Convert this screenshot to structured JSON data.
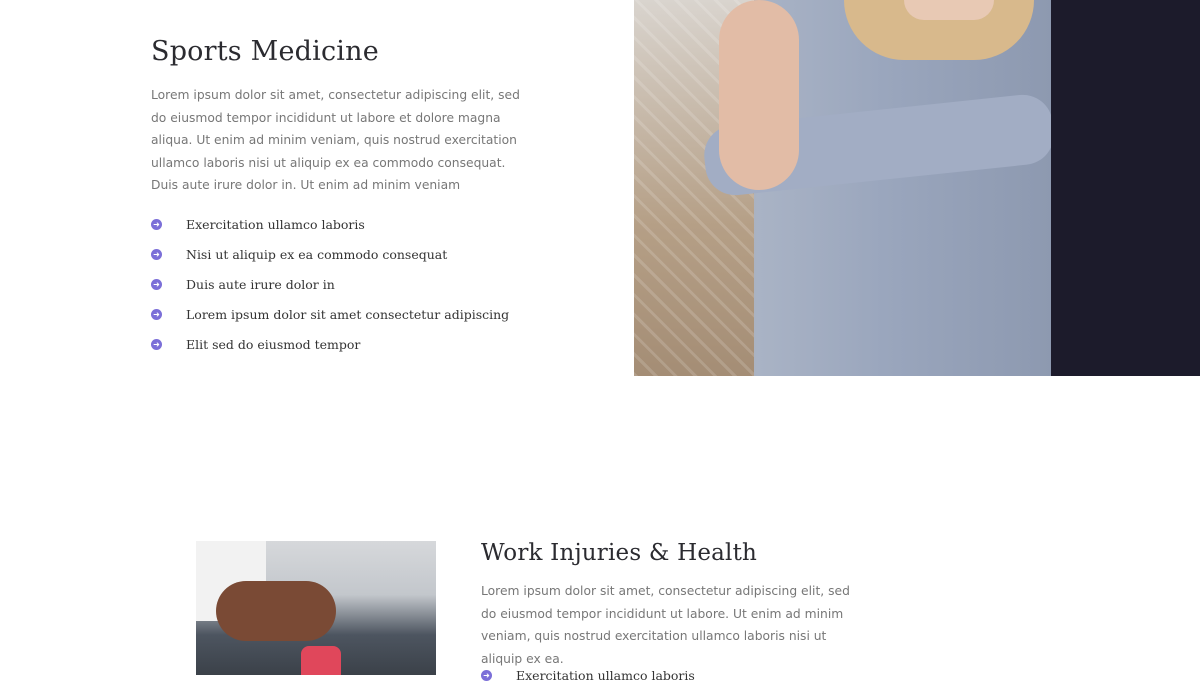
{
  "section1": {
    "title": "Sports Medicine",
    "body": "Lorem ipsum dolor sit amet, consectetur adipiscing elit, sed do eiusmod tempor incididunt ut labore et dolore magna aliqua. Ut enim ad minim veniam, quis nostrud exercitation ullamco laboris nisi ut aliquip ex ea commodo consequat. Duis aute irure dolor in. Ut enim ad minim veniam",
    "items": [
      "Exercitation ullamco laboris",
      "Nisi ut aliquip ex ea commodo consequat",
      "Duis aute irure dolor in",
      "Lorem ipsum dolor sit amet consectetur adipiscing",
      "Elit sed do eiusmod tempor"
    ]
  },
  "section2": {
    "title": "Work Injuries & Health",
    "body": "Lorem ipsum dolor sit amet, consectetur adipiscing elit, sed do eiusmod tempor incididunt ut labore. Ut enim ad minim veniam, quis nostrud exercitation ullamco laboris nisi ut aliquip ex ea.",
    "items": [
      "Exercitation ullamco laboris"
    ]
  },
  "colors": {
    "accent": "#7b6fd8",
    "dark_panel": "#1c1b2b"
  },
  "icons": {
    "bullet": "arrow-circle-right-icon"
  }
}
